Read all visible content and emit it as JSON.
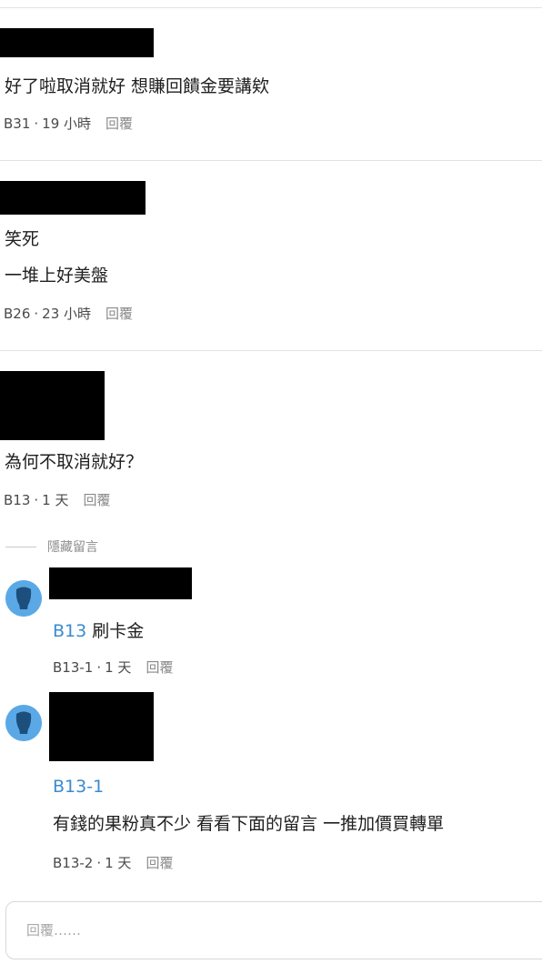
{
  "comments": [
    {
      "body_lines": [
        "好了啦取消就好 想賺回饋金要講欸"
      ],
      "floor": "B31",
      "time": "19 小時",
      "reply_label": "回覆"
    },
    {
      "body_lines": [
        "笑死",
        "一堆上好美盤"
      ],
      "floor": "B26",
      "time": "23 小時",
      "reply_label": "回覆"
    },
    {
      "body_lines": [
        "為何不取消就好？"
      ],
      "floor": "B13",
      "time": "1 天",
      "reply_label": "回覆"
    }
  ],
  "hidden_toggle_label": "隱藏留言",
  "replies": [
    {
      "avatar_icon": "user-silhouette-icon",
      "reply_to": "B13",
      "body": "刷卡金",
      "floor": "B13-1",
      "time": "1 天",
      "reply_label": "回覆"
    },
    {
      "avatar_icon": "user-silhouette-icon",
      "reply_to": "B13-1",
      "body": "有錢的果粉真不少 看看下面的留言 一推加價買轉單",
      "floor": "B13-2",
      "time": "1 天",
      "reply_label": "回覆"
    }
  ],
  "meta_separator": "·",
  "reply_input": {
    "placeholder": "回覆……"
  },
  "colors": {
    "floor_tag": "#3a8bd0",
    "avatar_bg": "#5aa9e6",
    "redaction": "#000000"
  }
}
